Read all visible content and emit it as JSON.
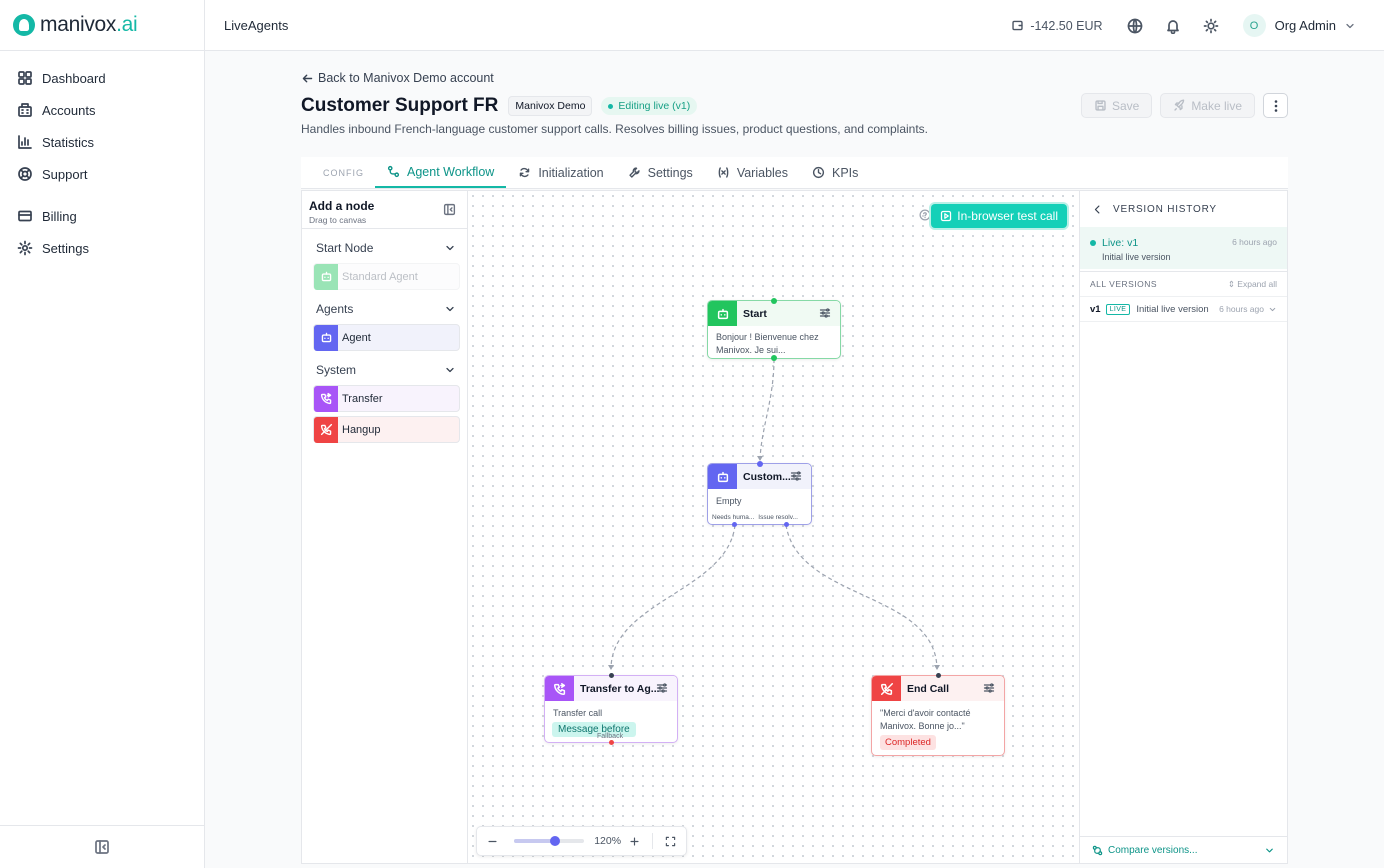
{
  "brand": {
    "name": "manivox",
    "suffix": ".ai"
  },
  "sidebar": {
    "items": [
      {
        "label": "Dashboard",
        "icon": "grid-icon"
      },
      {
        "label": "Accounts",
        "icon": "building-icon"
      },
      {
        "label": "Statistics",
        "icon": "bar-chart-icon"
      },
      {
        "label": "Support",
        "icon": "lifebuoy-icon"
      },
      {
        "label": "Billing",
        "icon": "credit-card-icon"
      },
      {
        "label": "Settings",
        "icon": "gear-icon"
      }
    ]
  },
  "header": {
    "breadcrumb": "LiveAgents",
    "balance": "-142.50 EUR",
    "user_initial": "O",
    "user_name": "Org Admin"
  },
  "page": {
    "back_label": "Back to Manivox Demo account",
    "title": "Customer Support FR",
    "account_badge": "Manivox Demo",
    "status_badge": "Editing live (v1)",
    "description": "Handles inbound French-language customer support calls. Resolves billing issues, product questions, and complaints.",
    "save_label": "Save",
    "make_live_label": "Make live"
  },
  "tabs": {
    "config_label": "CONFIG",
    "items": [
      {
        "label": "Agent Workflow",
        "icon": "workflow-icon",
        "active": true
      },
      {
        "label": "Initialization",
        "icon": "refresh-icon",
        "active": false
      },
      {
        "label": "Settings",
        "icon": "wrench-icon",
        "active": false
      },
      {
        "label": "Variables",
        "icon": "variable-icon",
        "active": false
      },
      {
        "label": "KPIs",
        "icon": "clock-icon",
        "active": false
      }
    ]
  },
  "palette": {
    "title": "Add a node",
    "subtitle": "Drag to canvas",
    "sections": {
      "start": "Start Node",
      "agents": "Agents",
      "system": "System"
    },
    "nodes": {
      "standard_agent": "Standard Agent",
      "agent": "Agent",
      "transfer": "Transfer",
      "hangup": "Hangup"
    }
  },
  "canvas": {
    "test_call_label": "In-browser test call",
    "zoom_label": "120%",
    "zoom_level": 0.58,
    "nodes": {
      "start": {
        "title": "Start",
        "body": "Bonjour ! Bienvenue chez Manivox. Je sui..."
      },
      "customer": {
        "title": "Custom...",
        "body": "Empty",
        "out1": "Needs huma...",
        "out2": "Issue resolv..."
      },
      "transfer": {
        "title": "Transfer to Ag...",
        "body": "Transfer call",
        "chip": "Message before",
        "fallback": "Fallback"
      },
      "end": {
        "title": "End Call",
        "body": "\"Merci d'avoir contacté Manivox. Bonne jo...\"",
        "chip": "Completed"
      }
    }
  },
  "history": {
    "title": "VERSION HISTORY",
    "live_label": "Live: v1",
    "live_desc": "Initial live version",
    "live_time": "6 hours ago",
    "all_label": "ALL VERSIONS",
    "expand_label": "Expand all",
    "versions": [
      {
        "version": "v1",
        "tag": "LIVE",
        "desc": "Initial live version",
        "time": "6 hours ago"
      }
    ],
    "compare_label": "Compare versions..."
  },
  "colors": {
    "accent": "#14b8a6",
    "agent": "#6366f1",
    "transfer": "#a855f7",
    "hangup": "#ef4444",
    "start": "#22c55e"
  }
}
